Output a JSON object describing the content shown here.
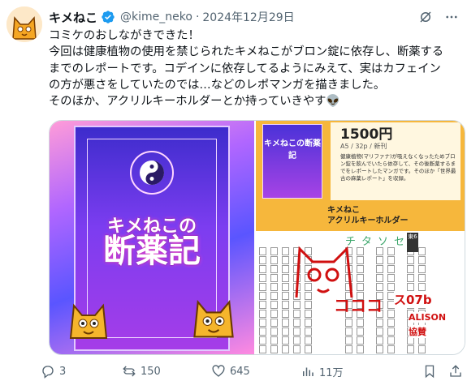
{
  "post": {
    "author_name": "キメねこ",
    "handle": "@kime_neko",
    "separator": "·",
    "date": "2024年12月29日",
    "text": "コミケのおしながきできた！\n今回は健康植物の使用を禁じられたキメねこがブロン錠に依存し、断薬する\nまでのレポートです。コデインに依存してるようにみえて、実はカフェイン\nの方が悪さをしていたのでは…などのレポマンガを描きました。\nそのほか、アクリルキーホルダーとか持っていきやす👽"
  },
  "media": {
    "cover": {
      "title_line1": "キメねこの",
      "title_line2": "断薬記"
    },
    "info": {
      "mini_cover_title": "キメねこの断薬記",
      "price": "1500円",
      "spec": "A5 / 32p / 新刊",
      "description": "健康植物(マリファナ)が吸えなくなったためブロン錠を飲んでいたら依存して、その後断薬するまでをレポートしたマンガです。そのほか「世界最古の麻薬レポート」を収録。",
      "keyholder": "キメねこ\nアクリルキーホルダー"
    },
    "map": {
      "columns": [
        "チ",
        "タ",
        "ソ",
        "セ"
      ],
      "sign": "東6",
      "handwritten_1": "コココ",
      "handwritten_2": "ス07b",
      "handwritten_3": "ALISON",
      "handwritten_4": "協賛"
    }
  },
  "actions": {
    "reply_count": "3",
    "retweet_count": "150",
    "like_count": "645",
    "views_count": "11万"
  },
  "colors": {
    "accent": "#1d9bf0",
    "muted": "#536471",
    "border": "#cfd9de",
    "verified": "#1d9bf0"
  }
}
